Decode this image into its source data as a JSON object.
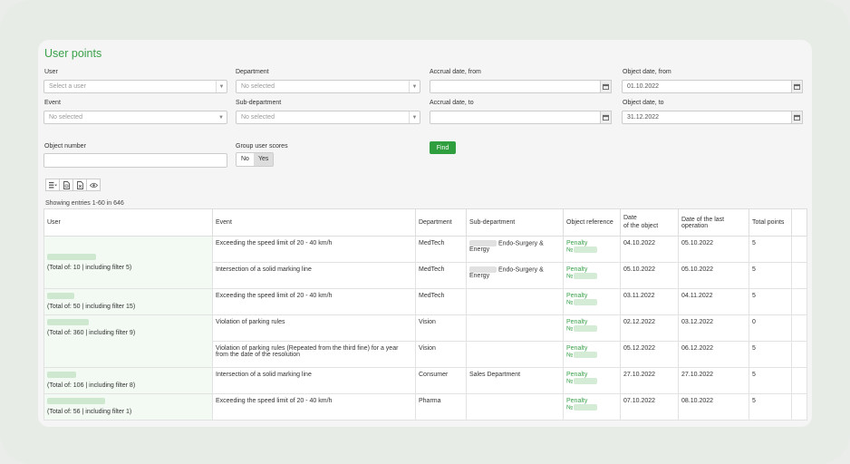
{
  "page_title": "User points",
  "filters": {
    "user_label": "User",
    "user_placeholder": "Select a user",
    "department_label": "Department",
    "department_value": "No selected",
    "accrual_from_label": "Accrual date, from",
    "object_from_label": "Object date, from",
    "object_from_value": "01.10.2022",
    "event_label": "Event",
    "event_value": "No selected",
    "subdepartment_label": "Sub-department",
    "subdepartment_value": "No selected",
    "accrual_to_label": "Accrual date, to",
    "object_to_label": "Object date, to",
    "object_to_value": "31.12.2022",
    "object_number_label": "Object number",
    "group_label": "Group user scores",
    "group_no": "No",
    "group_yes": "Yes",
    "find_label": "Find"
  },
  "showing": "Showing entries 1-60 in 646",
  "columns": [
    "User",
    "Event",
    "Department",
    "Sub-department",
    "Object reference",
    "Date\nof the object",
    "Date of the last operation",
    "Total points"
  ],
  "rows": [
    {
      "user_total": "(Total of: 10 | including filter 5)",
      "event": "Exceeding the speed limit of 20 - 40 km/h",
      "department": "MedTech",
      "subdepartment": "Endo-Surgery & Energy",
      "ref1": "Penalty",
      "ref2": "№",
      "date_object": "04.10.2022",
      "date_last": "05.10.2022",
      "points": "5"
    },
    {
      "user_total": "",
      "event": "Intersection of a solid marking line",
      "department": "MedTech",
      "subdepartment": "Endo-Surgery & Energy",
      "ref1": "Penalty",
      "ref2": "№",
      "date_object": "05.10.2022",
      "date_last": "05.10.2022",
      "points": "5"
    },
    {
      "user_total": "(Total of: 50 | including filter 15)",
      "event": "Exceeding the speed limit of 20 - 40 km/h",
      "department": "MedTech",
      "subdepartment": "",
      "ref1": "Penalty",
      "ref2": "№",
      "date_object": "03.11.2022",
      "date_last": "04.11.2022",
      "points": "5"
    },
    {
      "user_total": "(Total of: 360 | including filter 9)",
      "event": "Violation of parking rules",
      "department": "Vision",
      "subdepartment": "",
      "ref1": "Penalty",
      "ref2": "№",
      "date_object": "02.12.2022",
      "date_last": "03.12.2022",
      "points": "0"
    },
    {
      "user_total": "",
      "event": "Violation of parking rules (Repeated from the third fine) for a year from the date of the resolution",
      "department": "Vision",
      "subdepartment": "",
      "ref1": "Penalty",
      "ref2": "№",
      "date_object": "05.12.2022",
      "date_last": "06.12.2022",
      "points": "5"
    },
    {
      "user_total": "(Total of: 106 | including filter 8)",
      "event": "Intersection of a solid marking line",
      "department": "Consumer",
      "subdepartment": "Sales Department",
      "ref1": "Penalty",
      "ref2": "№",
      "date_object": "27.10.2022",
      "date_last": "27.10.2022",
      "points": "5"
    },
    {
      "user_total": "(Total of: 56 | including filter 1)",
      "event": "Exceeding the speed limit of 20 - 40 km/h",
      "department": "Pharma",
      "subdepartment": "",
      "ref1": "Penalty",
      "ref2": "№",
      "date_object": "07.10.2022",
      "date_last": "08.10.2022",
      "points": "5"
    }
  ]
}
